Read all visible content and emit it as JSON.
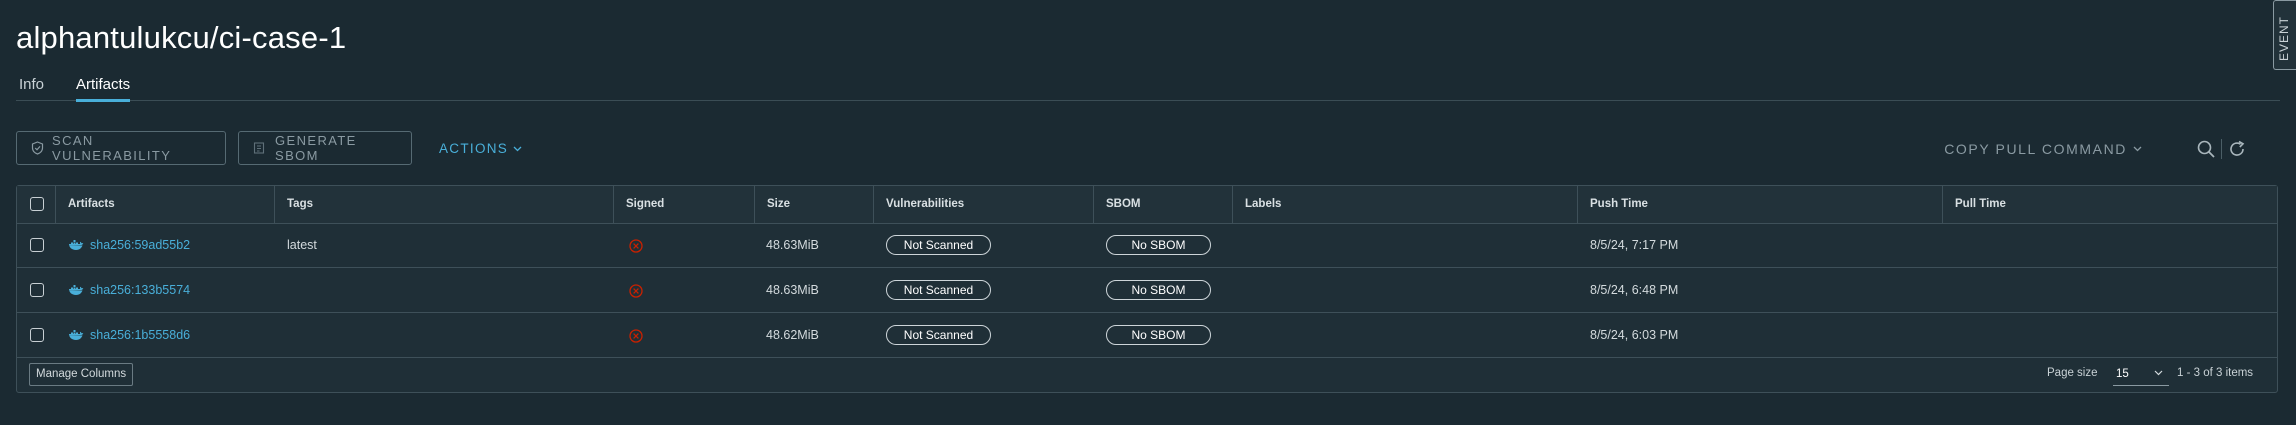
{
  "page": {
    "title": "alphantulukcu/ci-case-1"
  },
  "tabs": [
    {
      "label": "Info",
      "active": false
    },
    {
      "label": "Artifacts",
      "active": true
    }
  ],
  "toolbar": {
    "scan_label": "SCAN VULNERABILITY",
    "sbom_label": "GENERATE SBOM",
    "actions_label": "ACTIONS",
    "copy_pull_label": "COPY PULL COMMAND"
  },
  "table": {
    "columns": [
      "Artifacts",
      "Tags",
      "Signed",
      "Size",
      "Vulnerabilities",
      "SBOM",
      "Labels",
      "Push Time",
      "Pull Time"
    ],
    "rows": [
      {
        "artifact": "sha256:59ad55b2",
        "tag": "latest",
        "signed": false,
        "size": "48.63MiB",
        "vulnerabilities": "Not Scanned",
        "sbom": "No SBOM",
        "labels": "",
        "push_time": "8/5/24, 7:17 PM",
        "pull_time": ""
      },
      {
        "artifact": "sha256:133b5574",
        "tag": "",
        "signed": false,
        "size": "48.63MiB",
        "vulnerabilities": "Not Scanned",
        "sbom": "No SBOM",
        "labels": "",
        "push_time": "8/5/24, 6:48 PM",
        "pull_time": ""
      },
      {
        "artifact": "sha256:1b5558d6",
        "tag": "",
        "signed": false,
        "size": "48.62MiB",
        "vulnerabilities": "Not Scanned",
        "sbom": "No SBOM",
        "labels": "",
        "push_time": "8/5/24, 6:03 PM",
        "pull_time": ""
      }
    ]
  },
  "footer": {
    "manage_columns_label": "Manage Columns",
    "page_size_label": "Page size",
    "page_size_value": "15",
    "items_summary": "1 - 3 of 3 items"
  },
  "side_panel": {
    "event_label": "EVENT"
  },
  "icons": {
    "artifact": "docker-whale-icon",
    "signed_false": "x-circle-icon",
    "scan": "shield-check-icon",
    "sbom": "sbom-doc-icon",
    "search": "search-icon",
    "refresh": "refresh-icon"
  },
  "colors": {
    "background": "#1b2a32",
    "accent": "#49afd9",
    "error": "#c92100",
    "muted": "#8a9aa2"
  }
}
